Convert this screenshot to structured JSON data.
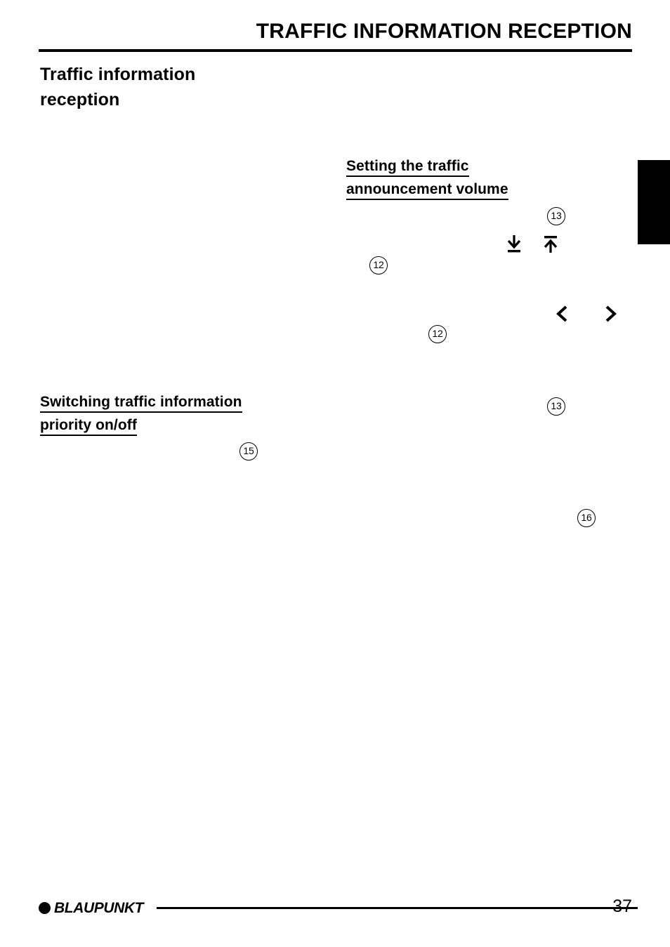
{
  "document": {
    "running_header": "TRAFFIC INFORMATION RECEPTION",
    "page_title_line1": "Traffic information",
    "page_title_line2": "reception",
    "page_number": "37"
  },
  "sections": {
    "volume": {
      "heading_line1": "Setting the traffic",
      "heading_line2": "announcement volume"
    },
    "priority": {
      "heading_line1": "Switching traffic information",
      "heading_line2": "priority on/off"
    }
  },
  "callouts": [
    {
      "id": "callout-13-top",
      "label": "13"
    },
    {
      "id": "callout-12-upper",
      "label": "12"
    },
    {
      "id": "callout-12-lower",
      "label": "12"
    },
    {
      "id": "callout-15",
      "label": "15"
    },
    {
      "id": "callout-13-right",
      "label": "13"
    },
    {
      "id": "callout-16",
      "label": "16"
    }
  ],
  "glyphs": [
    {
      "id": "glyph-down-bar",
      "name": "arrow-down-with-bar-icon"
    },
    {
      "id": "glyph-up-bar",
      "name": "arrow-up-with-bar-icon"
    },
    {
      "id": "glyph-chevron-left",
      "name": "chevron-left-icon"
    },
    {
      "id": "glyph-chevron-right",
      "name": "chevron-right-icon"
    }
  ],
  "footer": {
    "brand": "BLAUPUNKT"
  }
}
